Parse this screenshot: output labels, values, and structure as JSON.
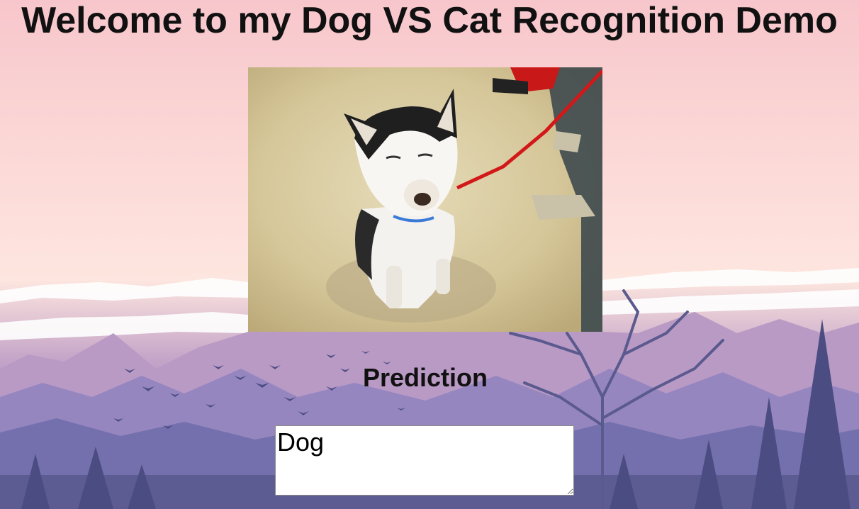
{
  "page": {
    "title": "Welcome to my Dog VS Cat Recognition Demo"
  },
  "prediction": {
    "label": "Prediction",
    "value": "Dog"
  },
  "colors": {
    "sky_top": "#f7c6cc",
    "mountain": "#8e82b9",
    "forest": "#5c5c92"
  }
}
